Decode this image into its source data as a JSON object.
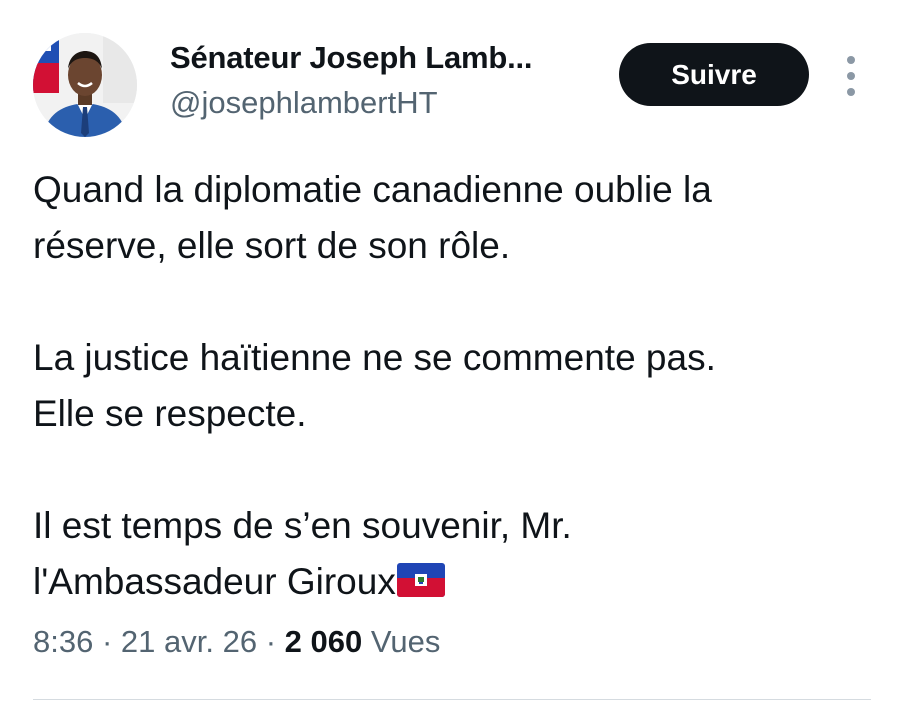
{
  "author": {
    "display_name": "Sénateur Joseph Lamb...",
    "handle": "@josephlambertHT",
    "avatar_icon": "profile-photo"
  },
  "follow_button": {
    "label": "Suivre"
  },
  "more_menu": {
    "icon": "vertical-ellipsis-icon"
  },
  "tweet": {
    "lines": [
      "Quand la diplomatie canadienne oublie la",
      "réserve, elle sort de son rôle.",
      "La justice haïtienne ne se commente pas.",
      "Elle se respecte.",
      "Il est temps de s’en souvenir, Mr.",
      "l'Ambassadeur Giroux"
    ],
    "flag_emoji": "haiti-flag-icon"
  },
  "meta": {
    "time": "8:36",
    "separator": "·",
    "date": "21 avr. 26",
    "views_count": "2 060",
    "views_label": "Vues"
  },
  "colors": {
    "text_primary": "#0f1419",
    "text_secondary": "#536471",
    "button_bg": "#0f1419",
    "button_text": "#ffffff",
    "divider": "#d5dbe0"
  }
}
